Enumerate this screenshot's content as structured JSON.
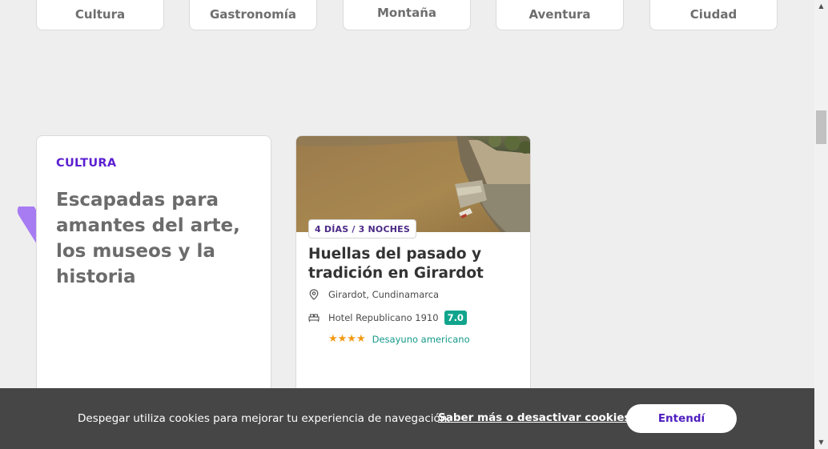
{
  "categories": [
    "Cultura",
    "Gastronomía",
    "Montaña",
    "Aventura",
    "Ciudad"
  ],
  "intro": {
    "eyebrow": "CULTURA",
    "title": "Escapadas para amantes del arte, los museos y la historia"
  },
  "trip": {
    "duration": "4 DÍAS / 3 NOCHES",
    "title": "Huellas del pasado y tradición en Girardot",
    "location": "Girardot, Cundinamarca",
    "hotel": "Hotel Republicano 1910",
    "score": "7.0",
    "stars": 4,
    "meal_plan": "Desayuno americano"
  },
  "cookie": {
    "message": "Despegar utiliza cookies para mejorar tu experiencia de navegación.",
    "link_label": "Saber más o desactivar cookies.",
    "accept_label": "Entendí"
  },
  "colors": {
    "brand_purple": "#5a1fd1",
    "score_green": "#11a48d",
    "star_orange": "#f29a14",
    "cookie_bg": "#464646",
    "deco_lilac": "#a77cf3"
  }
}
